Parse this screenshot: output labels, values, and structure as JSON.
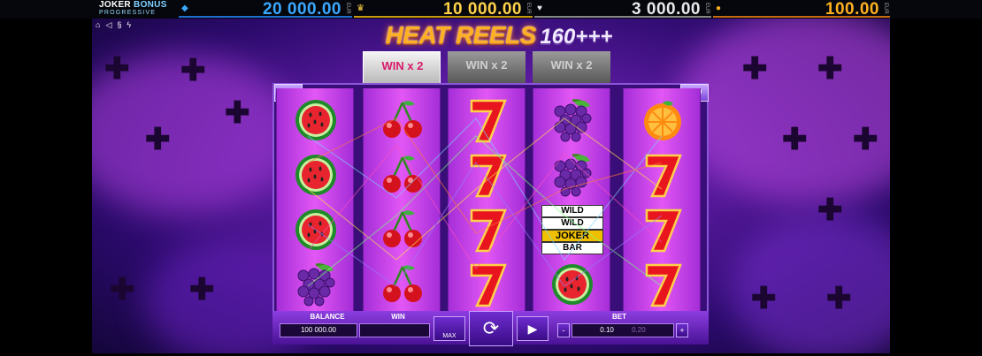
{
  "jackpot": {
    "logo_line1_a": "JOKER",
    "logo_line1_b": "BONUS",
    "logo_line2": "PROGRESSIVE",
    "tiers": [
      {
        "value": "20 000.00",
        "currency": "EUR",
        "color": "#3aa8ff",
        "icon": "diamond-icon"
      },
      {
        "value": "10 000.00",
        "currency": "EUR",
        "color": "#ffd24a",
        "icon": "crown-icon"
      },
      {
        "value": "3 000.00",
        "currency": "EUR",
        "color": "#e8e8e8",
        "icon": "heart-icon"
      },
      {
        "value": "100.00",
        "currency": "EUR",
        "color": "#ffb020",
        "icon": "coin-icon"
      }
    ]
  },
  "game": {
    "title_main": "HEAT REELS",
    "title_num": "160+++",
    "lines_left": "160",
    "lines_right": "160"
  },
  "multipliers": [
    "WIN x 2",
    "WIN x 2",
    "WIN x 2"
  ],
  "reels": [
    [
      "watermelon",
      "watermelon",
      "watermelon",
      "grapes"
    ],
    [
      "cherries",
      "cherries",
      "cherries",
      "cherries"
    ],
    [
      "seven",
      "seven",
      "seven",
      "seven"
    ],
    [
      "grapes",
      "grapes",
      "wild",
      "watermelon"
    ],
    [
      "orange",
      "seven",
      "seven",
      "seven"
    ]
  ],
  "wild_symbol": {
    "line1": "WILD",
    "line2": "WILD",
    "line3": "JOKER",
    "line4": "BAR"
  },
  "controls": {
    "balance_label": "BALANCE",
    "balance_value": "100 000.00",
    "win_label": "WIN",
    "win_value": "",
    "max_label": "MAX",
    "bet_label": "BET",
    "bet_value": "0.10",
    "bet_next": "0.20",
    "minus": "-",
    "plus": "+"
  },
  "colors": {
    "accent": "#ffb020",
    "reel": "#e257f5"
  }
}
